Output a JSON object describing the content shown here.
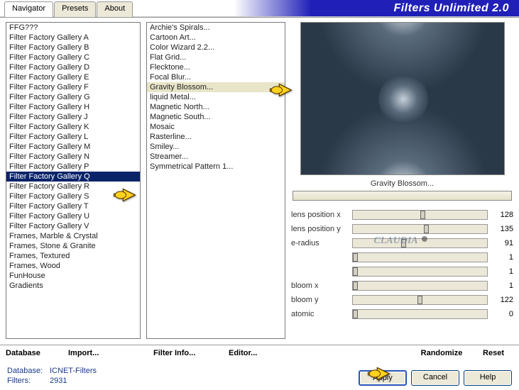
{
  "app_title": "Filters Unlimited 2.0",
  "tabs": [
    {
      "label": "Navigator",
      "active": true
    },
    {
      "label": "Presets",
      "active": false
    },
    {
      "label": "About",
      "active": false
    }
  ],
  "categories": [
    "FFG???",
    "Filter Factory Gallery A",
    "Filter Factory Gallery B",
    "Filter Factory Gallery C",
    "Filter Factory Gallery D",
    "Filter Factory Gallery E",
    "Filter Factory Gallery F",
    "Filter Factory Gallery G",
    "Filter Factory Gallery H",
    "Filter Factory Gallery J",
    "Filter Factory Gallery K",
    "Filter Factory Gallery L",
    "Filter Factory Gallery M",
    "Filter Factory Gallery N",
    "Filter Factory Gallery P",
    "Filter Factory Gallery Q",
    "Filter Factory Gallery R",
    "Filter Factory Gallery S",
    "Filter Factory Gallery T",
    "Filter Factory Gallery U",
    "Filter Factory Gallery V",
    "Frames, Marble & Crystal",
    "Frames, Stone & Granite",
    "Frames, Textured",
    "Frames, Wood",
    "FunHouse",
    "Gradients"
  ],
  "selected_category_index": 15,
  "filters": [
    "Archie's Spirals...",
    "Cartoon Art...",
    "Color Wizard 2.2...",
    "Flat Grid...",
    "Flecktone...",
    "Focal Blur...",
    "Gravity Blossom...",
    "liquid Metal...",
    "Magnetic North...",
    "Magnetic South...",
    "Mosaic",
    "Rasterline...",
    "Smiley...",
    "Streamer...",
    "Symmetrical Pattern 1..."
  ],
  "highlighted_filter_index": 6,
  "current_filter": "Gravity Blossom...",
  "watermark": "CLAUDIA",
  "params": [
    {
      "label": "lens position x",
      "value": 128,
      "pos": 50
    },
    {
      "label": "lens position y",
      "value": 135,
      "pos": 53
    },
    {
      "label": "e-radius",
      "value": 91,
      "pos": 36
    },
    {
      "label": "",
      "value": 1,
      "pos": 0
    },
    {
      "label": "",
      "value": 1,
      "pos": 0
    },
    {
      "label": "bloom x",
      "value": 1,
      "pos": 0
    },
    {
      "label": "bloom y",
      "value": 122,
      "pos": 48
    },
    {
      "label": "atomic",
      "value": 0,
      "pos": 0
    }
  ],
  "button_bar": {
    "database": "Database",
    "import": "Import...",
    "filter_info": "Filter Info...",
    "editor": "Editor...",
    "randomize": "Randomize",
    "reset": "Reset"
  },
  "status": {
    "db_label": "Database:",
    "db_value": "ICNET-Filters",
    "filters_label": "Filters:",
    "filters_value": "2931"
  },
  "footer_buttons": {
    "apply": "Apply",
    "cancel": "Cancel",
    "help": "Help"
  }
}
